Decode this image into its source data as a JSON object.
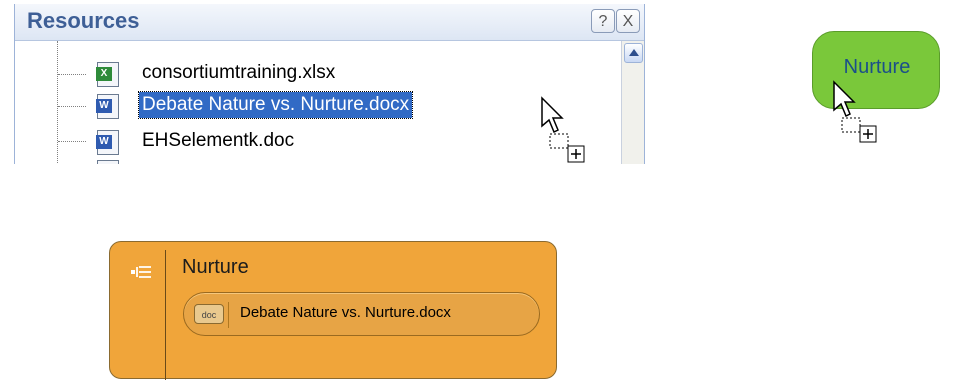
{
  "resources_panel": {
    "title": "Resources",
    "help_button": "?",
    "close_button": "X",
    "files": [
      {
        "name": "consortiumtraining.xlsx",
        "type": "excel",
        "badge": "X",
        "selected": false
      },
      {
        "name": "Debate Nature vs. Nurture.docx",
        "type": "word",
        "badge": "W",
        "selected": true
      },
      {
        "name": "EHSelementk.doc",
        "type": "word",
        "badge": "W",
        "selected": false
      }
    ]
  },
  "drag_node": {
    "label": "Nurture",
    "color": "#7ac83a",
    "text_color": "#1b4f8a"
  },
  "topic_card": {
    "title": "Nurture",
    "color": "#f0a53a",
    "attachment": {
      "badge": "doc",
      "label": "Debate Nature vs. Nurture.docx"
    }
  },
  "icons": [
    "help-icon",
    "close-icon",
    "scroll-up-icon",
    "excel-file-icon",
    "word-file-icon",
    "drag-copy-cursor-icon",
    "outline-icon"
  ]
}
